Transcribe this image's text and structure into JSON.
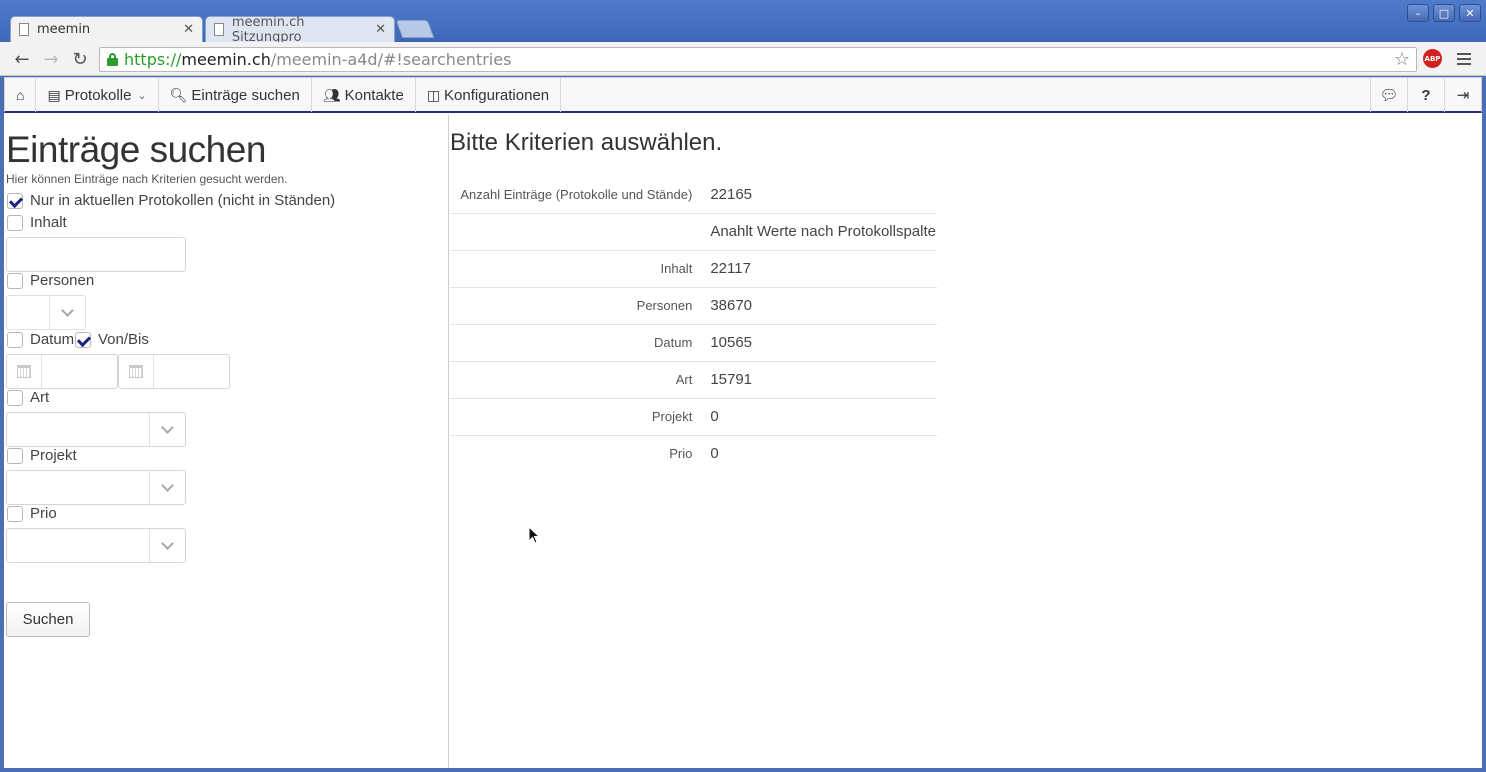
{
  "browser": {
    "tabs": [
      {
        "title": "meemin",
        "active": true
      },
      {
        "title": "meemin.ch Sitzungpro",
        "active": false
      }
    ],
    "url": {
      "scheme": "https://",
      "host": "meemin.ch",
      "path": "/meemin-a4d/#!searchentries"
    },
    "window_buttons": [
      "minimize",
      "maximize",
      "close"
    ],
    "extension": "ABP"
  },
  "app_nav": {
    "home_icon": "home-icon",
    "protokolle": "Protokolle",
    "eintraege_suchen": "Einträge suchen",
    "kontakte": "Kontakte",
    "konfigurationen": "Konfigurationen",
    "right_icons": [
      "comment-icon",
      "help-icon",
      "logout-icon"
    ],
    "help_label": "?"
  },
  "search_form": {
    "title": "Einträge suchen",
    "description": "Hier können Einträge nach Kriterien gesucht werden.",
    "only_current": {
      "label": "Nur in aktuellen Protokollen (nicht in Ständen)",
      "checked": true
    },
    "inhalt": {
      "label": "Inhalt",
      "checked": false,
      "value": ""
    },
    "personen": {
      "label": "Personen",
      "checked": false,
      "value": ""
    },
    "datum": {
      "label": "Datum",
      "checked": false
    },
    "von_bis": {
      "label": "Von/Bis",
      "checked": true,
      "from": "",
      "to": ""
    },
    "art": {
      "label": "Art",
      "checked": false,
      "value": ""
    },
    "projekt": {
      "label": "Projekt",
      "checked": false,
      "value": ""
    },
    "prio": {
      "label": "Prio",
      "checked": false,
      "value": ""
    },
    "submit": "Suchen"
  },
  "results": {
    "heading": "Bitte Kriterien auswählen.",
    "rows": [
      {
        "key": "Anzahl Einträge (Protokolle und Stände)",
        "value": "22165"
      },
      {
        "key": "",
        "value": "Anahlt Werte nach Protokollspalte"
      },
      {
        "key": "Inhalt",
        "value": "22117"
      },
      {
        "key": "Personen",
        "value": "38670"
      },
      {
        "key": "Datum",
        "value": "10565"
      },
      {
        "key": "Art",
        "value": "15791"
      },
      {
        "key": "Projekt",
        "value": "0"
      },
      {
        "key": "Prio",
        "value": "0"
      }
    ]
  }
}
